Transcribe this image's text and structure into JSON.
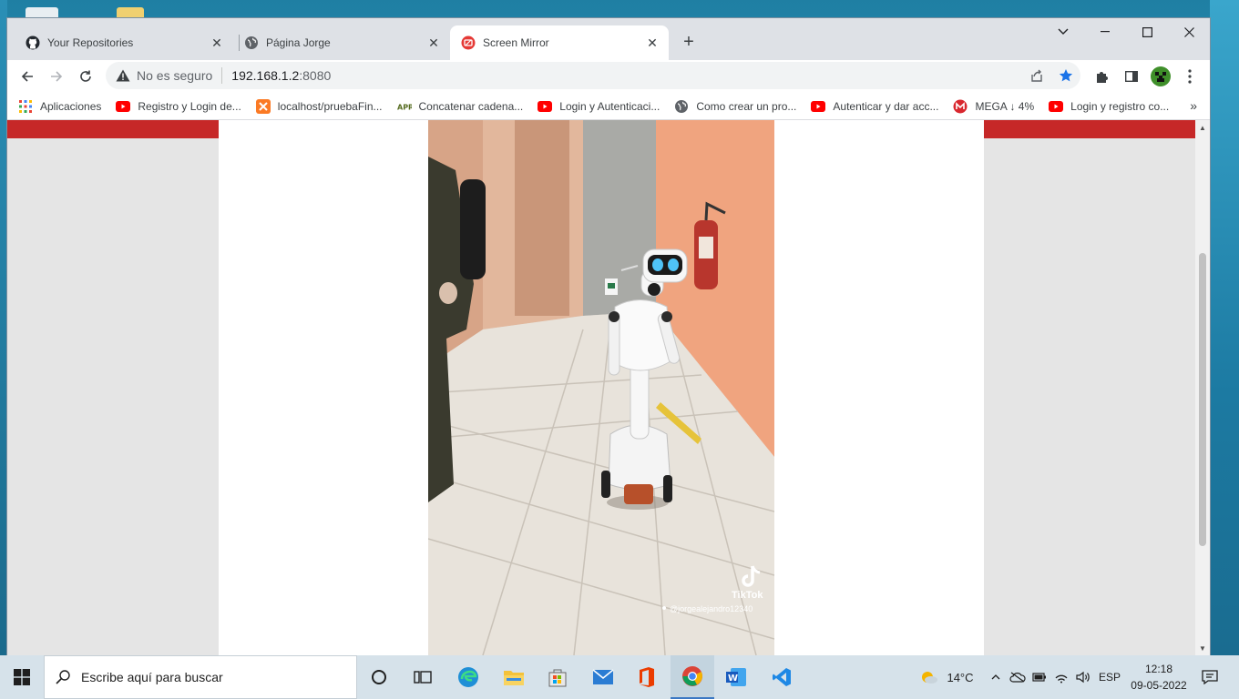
{
  "browser": {
    "tabs": [
      {
        "title": "Your Repositories",
        "icon": "github-icon",
        "active": false
      },
      {
        "title": "Página Jorge",
        "icon": "globe-icon",
        "active": false
      },
      {
        "title": "Screen Mirror",
        "icon": "screen-mirror-icon",
        "active": true
      }
    ],
    "address": {
      "security_label": "No es seguro",
      "host": "192.168.1.2",
      "port": ":8080"
    },
    "bookmarks": [
      {
        "label": "Aplicaciones",
        "icon": "apps-grid-icon"
      },
      {
        "label": "Registro y Login de...",
        "icon": "youtube-icon"
      },
      {
        "label": "localhost/pruebaFin...",
        "icon": "xampp-icon"
      },
      {
        "label": "Concatenar cadena...",
        "icon": "apr-icon"
      },
      {
        "label": "Login y Autenticaci...",
        "icon": "youtube-icon"
      },
      {
        "label": "Como crear un pro...",
        "icon": "globe-icon"
      },
      {
        "label": "Autenticar y dar acc...",
        "icon": "youtube-icon"
      },
      {
        "label": "MEGA ↓ 4%",
        "icon": "mega-icon"
      },
      {
        "label": "Login y registro co...",
        "icon": "youtube-icon"
      }
    ],
    "bookmarks_more": "»"
  },
  "video": {
    "watermark_brand": "TikTok",
    "watermark_user": "@jorgealejandro12340"
  },
  "taskbar": {
    "search_placeholder": "Escribe aquí para buscar",
    "weather": "14°C",
    "language": "ESP",
    "time": "12:18",
    "date": "09-05-2022"
  },
  "colors": {
    "page_red_bar": "#c62828",
    "tab_strip": "#dee1e6",
    "star_blue": "#1a73e8",
    "taskbar": "#d6e2ea"
  }
}
